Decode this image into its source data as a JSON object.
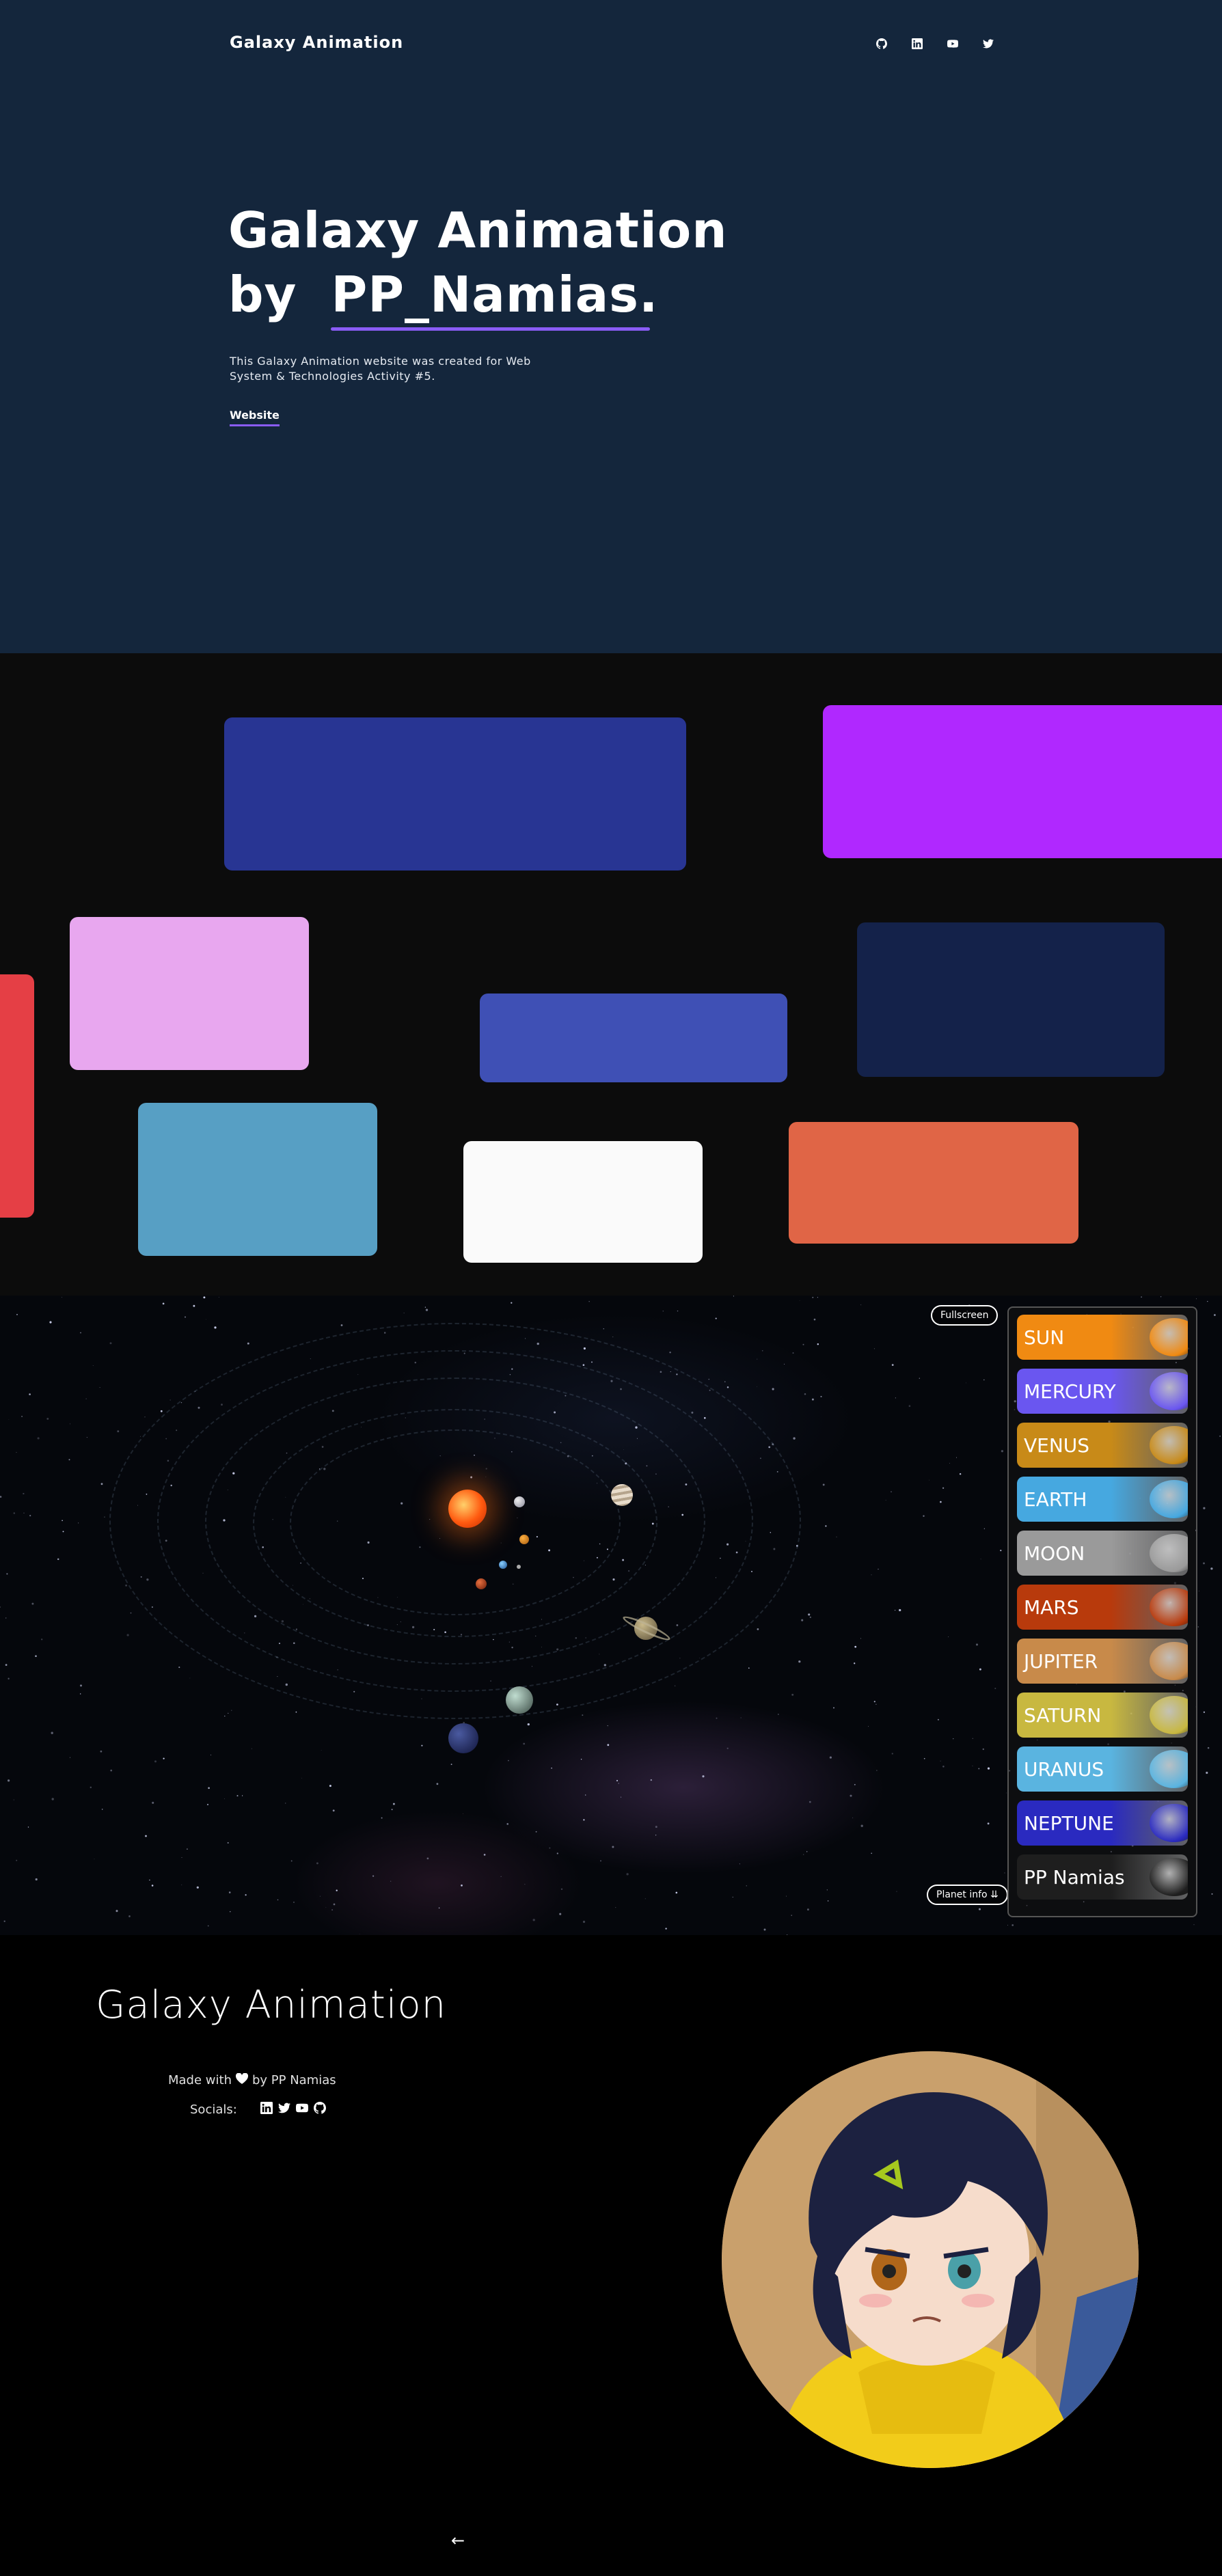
{
  "header": {
    "brand": "Galaxy Animation",
    "social_icons": [
      "github-icon",
      "linkedin-icon",
      "youtube-icon",
      "twitter-icon"
    ]
  },
  "hero": {
    "title_line1": "Galaxy Animation",
    "title_by": "by",
    "title_name": "PP_Namias.",
    "description": "This Galaxy Animation website was created for Web System & Technologies Activity #5.",
    "link_label": "Website",
    "accent_color": "#8a5cf6",
    "background": "#14263c"
  },
  "cards": {
    "background": "#0c0c0c",
    "colors": [
      "#283593",
      "#b028ff",
      "#e53f45",
      "#e8a7ef",
      "#3f50b5",
      "#14224a",
      "#579fc4",
      "#fafafa",
      "#e06546"
    ]
  },
  "solar_system": {
    "fullscreen_label": "Fullscreen",
    "planet_info_label": "Planet info",
    "planets": [
      {
        "name": "SUN",
        "color": "#f08a12"
      },
      {
        "name": "MERCURY",
        "color": "#6a56f0"
      },
      {
        "name": "VENUS",
        "color": "#c88a18"
      },
      {
        "name": "EARTH",
        "color": "#46a8e0"
      },
      {
        "name": "MOON",
        "color": "#9a9a9a"
      },
      {
        "name": "MARS",
        "color": "#b83a0c"
      },
      {
        "name": "JUPITER",
        "color": "#c88a4a"
      },
      {
        "name": "SATURN",
        "color": "#c8b840"
      },
      {
        "name": "URANUS",
        "color": "#5ab4e0"
      },
      {
        "name": "NEPTUNE",
        "color": "#2a2ac0"
      },
      {
        "name": "PP Namias",
        "color": "#1e1e1e"
      }
    ]
  },
  "footer": {
    "title": "Galaxy Animation",
    "made_with_prefix": "Made with",
    "made_with_suffix": "by PP Namias",
    "socials_label": "Socials:",
    "social_icons": [
      "linkedin-icon",
      "twitter-icon",
      "youtube-icon",
      "github-icon"
    ],
    "back_arrow": "←"
  }
}
